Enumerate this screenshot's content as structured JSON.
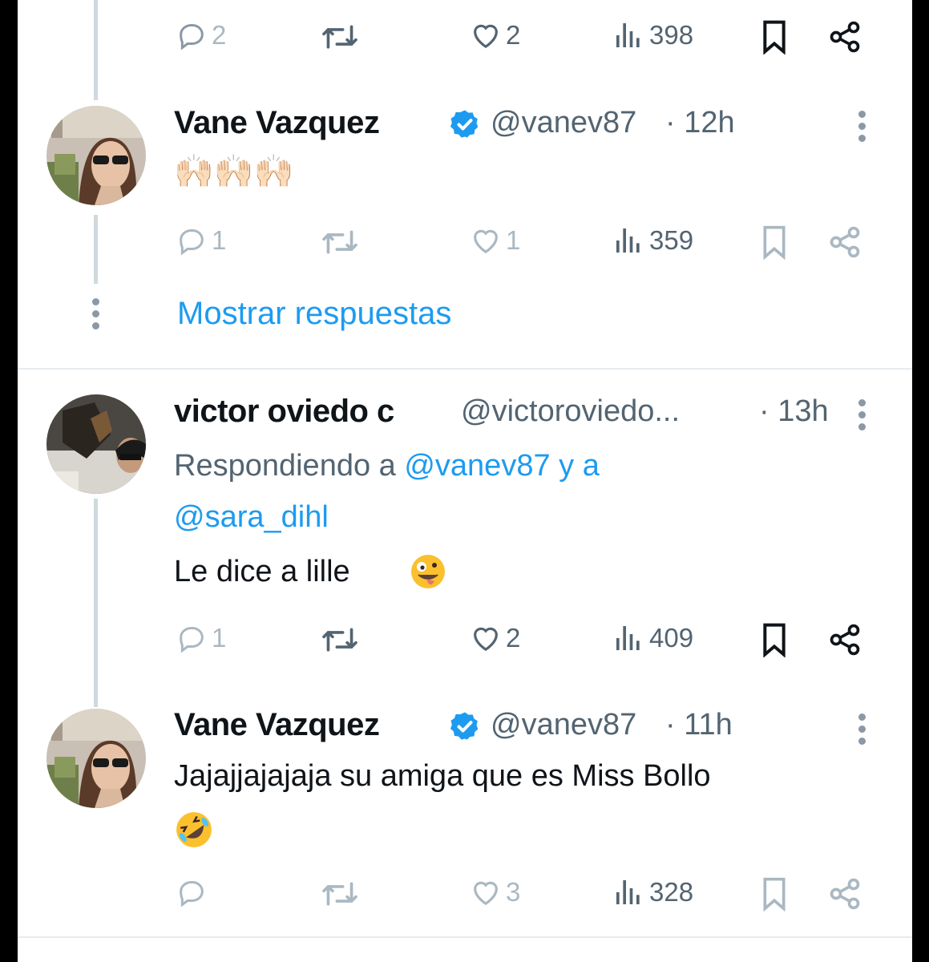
{
  "top_action_bar": {
    "replies": "2",
    "likes": "2",
    "views": "398"
  },
  "tweets": [
    {
      "author": "Vane Vazquez",
      "handle": "@vanev87",
      "time": "· 12h",
      "text": "🙌🏻🙌🏻🙌🏻",
      "replies": "1",
      "retweets": "",
      "likes": "1",
      "views": "359"
    },
    {
      "author": "victor oviedo c",
      "handle": "@victoroviedo...",
      "time": "· 13h",
      "replying_prefix": "Respondiendo a ",
      "replying_user1": "@vanev87",
      "replying_conj": " y a",
      "replying_user2": "@sara_dihl",
      "text": "Le dice a lille",
      "replies": "1",
      "retweets": "",
      "likes": "2",
      "views": "409"
    },
    {
      "author": "Vane Vazquez",
      "handle": "@vanev87",
      "time": "· 11h",
      "text": "Jajajjajajaja su amiga que es Miss Bollo",
      "replies": "",
      "retweets": "",
      "likes": "3",
      "views": "328"
    }
  ],
  "show_replies_label": "Mostrar respuestas",
  "colors": {
    "accent": "#1d9bf0",
    "secondary_text": "#536471",
    "thread_line": "#cfd9de",
    "verified": "#1d9bf0"
  },
  "icons": [
    "reply-icon",
    "retweet-icon",
    "like-icon",
    "views-icon",
    "bookmark-icon",
    "share-icon",
    "verified-badge-icon",
    "more-options-icon"
  ]
}
